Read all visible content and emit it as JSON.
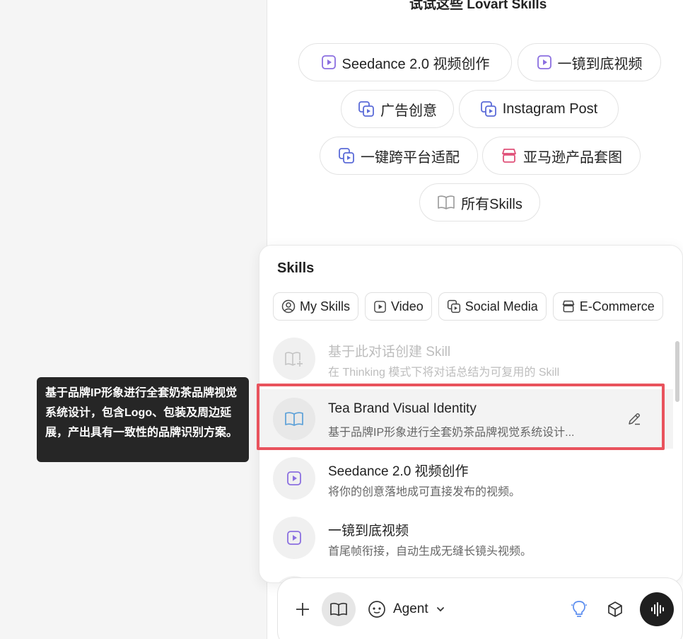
{
  "suggestions": {
    "title": "试试这些 Lovart Skills",
    "chips": [
      {
        "label": "Seedance 2.0 视频创作",
        "icon": "video-play-icon"
      },
      {
        "label": "一镜到底视频",
        "icon": "video-play-icon"
      },
      {
        "label": "广告创意",
        "icon": "social-media-icon"
      },
      {
        "label": "Instagram Post",
        "icon": "social-media-icon"
      },
      {
        "label": "一键跨平台适配",
        "icon": "social-media-icon"
      },
      {
        "label": "亚马逊产品套图",
        "icon": "storefront-icon"
      },
      {
        "label": "所有Skills",
        "icon": "book-icon"
      }
    ]
  },
  "skills_popup": {
    "title": "Skills",
    "tabs": [
      {
        "label": "My Skills",
        "icon": "user-circle-icon"
      },
      {
        "label": "Video",
        "icon": "video-play-icon"
      },
      {
        "label": "Social Media",
        "icon": "social-media-icon"
      },
      {
        "label": "E-Commerce",
        "icon": "storefront-icon"
      }
    ],
    "items": [
      {
        "name": "基于此对话创建 Skill",
        "desc": "在 Thinking 模式下将对话总结为可复用的 Skill",
        "icon": "book-plus-icon",
        "state": "disabled"
      },
      {
        "name": "Tea Brand Visual Identity",
        "desc": "基于品牌IP形象进行全套奶茶品牌视觉系统设计...",
        "icon": "book-icon",
        "state": "hovered"
      },
      {
        "name": "Seedance 2.0 视频创作",
        "desc": "将你的创意落地成可直接发布的视频。",
        "icon": "video-play-icon",
        "state": "normal"
      },
      {
        "name": "一镜到底视频",
        "desc": "首尾帧衔接，自动生成无缝长镜头视频。",
        "icon": "video-play-icon",
        "state": "normal"
      }
    ]
  },
  "tooltip": {
    "text": "基于品牌IP形象进行全套奶茶品牌视觉系统设计，包含Logo、包装及周边延展，产出具有一致性的品牌识别方案。"
  },
  "input_bar": {
    "agent_label": "Agent"
  },
  "colors": {
    "video_icon": "#8b6fe0",
    "social_icon": "#5b6bd8",
    "store_icon": "#e0527a",
    "highlight_border": "#e9535d",
    "tooltip_bg": "#262626",
    "lightbulb": "#5b8def"
  }
}
